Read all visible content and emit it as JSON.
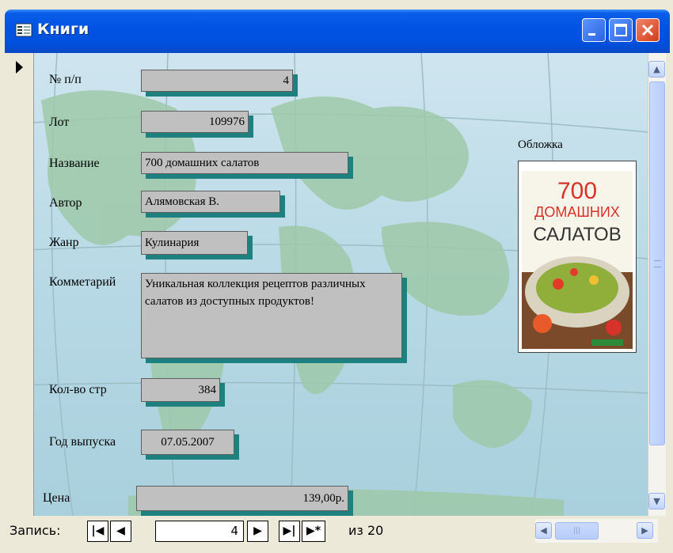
{
  "window": {
    "title": "Книги",
    "accent": "#0054E3",
    "close_color": "#D23C1A"
  },
  "icons": [
    "form-icon",
    "minimize-icon",
    "maximize-icon",
    "close-icon",
    "record-selector-arrow-icon",
    "scroll-up-icon",
    "scroll-down-icon",
    "scroll-left-icon",
    "scroll-right-icon",
    "first-record-icon",
    "prev-record-icon",
    "next-record-icon",
    "last-record-icon",
    "new-record-icon"
  ],
  "form": {
    "fields": {
      "num": {
        "label": "№ п/п",
        "value": "4"
      },
      "lot": {
        "label": "Лот",
        "value": "109976"
      },
      "title": {
        "label": "Название",
        "value": "700 домашних салатов"
      },
      "author": {
        "label": "Автор",
        "value": "Алямовская В."
      },
      "genre": {
        "label": "Жанр",
        "value": "Кулинария"
      },
      "comment": {
        "label": "Комметарий",
        "value": "Уникальная коллекция рецептов различных салатов из доступных продуктов!"
      },
      "pages": {
        "label": "Кол-во стр",
        "value": "384"
      },
      "year": {
        "label": "Год выпуска",
        "value": "07.05.2007"
      },
      "price": {
        "label": "Цена",
        "value": "139,00р."
      }
    },
    "cover": {
      "label": "Обложка",
      "line1": "700",
      "line2": "ДОМАШНИХ",
      "line3": "САЛАТОВ"
    }
  },
  "navigation": {
    "label": "Запись:",
    "current": "4",
    "of_label": "из 20"
  }
}
